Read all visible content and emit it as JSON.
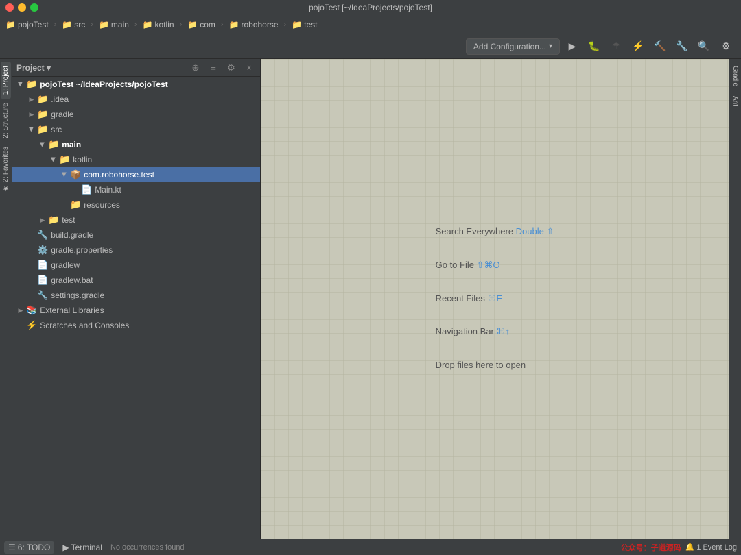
{
  "window": {
    "title": "pojoTest [~/IdeaProjects/pojoTest]"
  },
  "nav": {
    "items": [
      {
        "label": "pojoTest",
        "icon": "📁",
        "id": "nav-project"
      },
      {
        "label": "src",
        "icon": "📁",
        "id": "nav-src"
      },
      {
        "label": "main",
        "icon": "📁",
        "id": "nav-main"
      },
      {
        "label": "kotlin",
        "icon": "📁",
        "id": "nav-kotlin"
      },
      {
        "label": "com",
        "icon": "📁",
        "id": "nav-com"
      },
      {
        "label": "robohorse",
        "icon": "📁",
        "id": "nav-robohorse"
      },
      {
        "label": "test",
        "icon": "📁",
        "id": "nav-test"
      }
    ]
  },
  "toolbar": {
    "add_config_label": "Add Configuration...",
    "add_config_dropdown": "▾"
  },
  "project_panel": {
    "title": "Project",
    "dropdown_arrow": "▾"
  },
  "tree": {
    "items": [
      {
        "id": "pojo-root",
        "label": "pojoTest",
        "suffix": " ~/IdeaProjects/pojoTest",
        "indent": 0,
        "icon": "📁",
        "arrow": "open",
        "bold": true
      },
      {
        "id": "idea",
        "label": ".idea",
        "indent": 1,
        "icon": "📁",
        "arrow": "closed"
      },
      {
        "id": "gradle",
        "label": "gradle",
        "indent": 1,
        "icon": "📁",
        "arrow": "closed"
      },
      {
        "id": "src",
        "label": "src",
        "indent": 1,
        "icon": "📁",
        "arrow": "open"
      },
      {
        "id": "main",
        "label": "main",
        "indent": 2,
        "icon": "📁",
        "arrow": "open",
        "bold": true
      },
      {
        "id": "kotlin",
        "label": "kotlin",
        "indent": 3,
        "icon": "📁",
        "arrow": "open"
      },
      {
        "id": "com.robohorse.test",
        "label": "com.robohorse.test",
        "indent": 4,
        "icon": "📦",
        "arrow": "open",
        "selected": true
      },
      {
        "id": "Main.kt",
        "label": "Main.kt",
        "indent": 5,
        "icon": "📄",
        "arrow": "none"
      },
      {
        "id": "resources",
        "label": "resources",
        "indent": 4,
        "icon": "📁",
        "arrow": "none"
      },
      {
        "id": "test",
        "label": "test",
        "indent": 2,
        "icon": "📁",
        "arrow": "closed"
      },
      {
        "id": "build.gradle",
        "label": "build.gradle",
        "indent": 1,
        "icon": "🔧",
        "arrow": "none"
      },
      {
        "id": "gradle.properties",
        "label": "gradle.properties",
        "indent": 1,
        "icon": "⚙️",
        "arrow": "none"
      },
      {
        "id": "gradlew",
        "label": "gradlew",
        "indent": 1,
        "icon": "📄",
        "arrow": "none"
      },
      {
        "id": "gradlew.bat",
        "label": "gradlew.bat",
        "indent": 1,
        "icon": "📄",
        "arrow": "none"
      },
      {
        "id": "settings.gradle",
        "label": "settings.gradle",
        "indent": 1,
        "icon": "🔧",
        "arrow": "none"
      },
      {
        "id": "external-libs",
        "label": "External Libraries",
        "indent": 0,
        "icon": "📚",
        "arrow": "closed"
      },
      {
        "id": "scratches",
        "label": "Scratches and Consoles",
        "indent": 0,
        "icon": "⚡",
        "arrow": "none"
      }
    ]
  },
  "editor": {
    "hints": [
      {
        "id": "search-everywhere",
        "text_before": "Search Everywhere ",
        "shortcut": "Double ⇧",
        "text_after": ""
      },
      {
        "id": "go-to-file",
        "text_before": "Go to File ",
        "shortcut": "⇧⌘O",
        "text_after": ""
      },
      {
        "id": "recent-files",
        "text_before": "Recent Files ",
        "shortcut": "⌘E",
        "text_after": ""
      },
      {
        "id": "navigation-bar",
        "text_before": "Navigation Bar ",
        "shortcut": "⌘↑",
        "text_after": ""
      },
      {
        "id": "drop-files",
        "text_before": "Drop files here to open",
        "shortcut": "",
        "text_after": ""
      }
    ]
  },
  "right_tabs": {
    "items": [
      {
        "label": "Gradle",
        "id": "right-tab-gradle"
      },
      {
        "label": "Ant",
        "id": "right-tab-ant"
      }
    ]
  },
  "left_tabs": {
    "items": [
      {
        "label": "1: Project",
        "id": "left-tab-project"
      },
      {
        "label": "2: Structure",
        "id": "left-tab-structure"
      },
      {
        "label": "2: Favorites",
        "id": "left-tab-favorites"
      }
    ]
  },
  "bottom": {
    "tabs": [
      {
        "label": "6: TODO",
        "icon": "☰",
        "id": "bottom-tab-todo"
      },
      {
        "label": "Terminal",
        "icon": "▶",
        "id": "bottom-tab-terminal"
      }
    ],
    "status": "No occurrences found",
    "watermark": "公众号：子道源码",
    "event_log": "Event Log",
    "notification_count": "1"
  }
}
